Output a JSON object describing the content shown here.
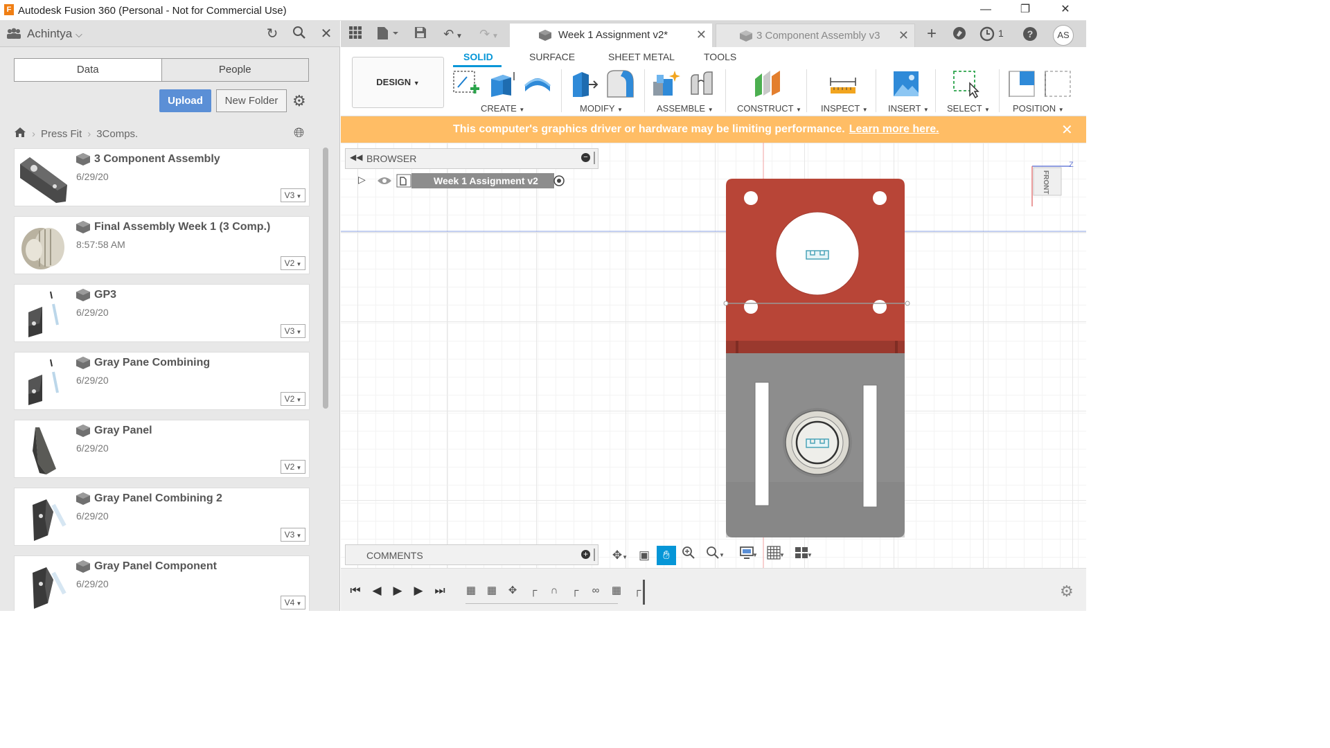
{
  "window": {
    "title": "Autodesk Fusion 360 (Personal - Not for Commercial Use)",
    "logo_letter": "F",
    "controls": [
      "—",
      "❐",
      "✕"
    ]
  },
  "data_panel": {
    "user": "Achintya",
    "tabs": [
      "Data",
      "People"
    ],
    "upload_label": "Upload",
    "new_folder_label": "New Folder",
    "breadcrumb": [
      "Press Fit",
      "3Comps."
    ],
    "files": [
      {
        "name": "3 Component Assembly",
        "date": "6/29/20",
        "version": "V3",
        "thumb": "plate"
      },
      {
        "name": "Final Assembly Week 1 (3 Comp.)",
        "date": "8:57:58 AM",
        "version": "V2",
        "thumb": "disc"
      },
      {
        "name": "GP3",
        "date": "6/29/20",
        "version": "V3",
        "thumb": "bracket"
      },
      {
        "name": "Gray Pane Combining",
        "date": "6/29/20",
        "version": "V2",
        "thumb": "bracket"
      },
      {
        "name": "Gray Panel",
        "date": "6/29/20",
        "version": "V2",
        "thumb": "panel"
      },
      {
        "name": "Gray Panel Combining 2",
        "date": "6/29/20",
        "version": "V3",
        "thumb": "bracket2"
      },
      {
        "name": "Gray Panel Component",
        "date": "6/29/20",
        "version": "V4",
        "thumb": "bracket2"
      }
    ]
  },
  "doc_tabs": [
    {
      "label": "Week 1 Assignment v2*",
      "active": true
    },
    {
      "label": "3 Component Assembly v3",
      "active": false
    }
  ],
  "header_right": {
    "job_count": "1",
    "avatar_initials": "AS"
  },
  "ribbon": {
    "workspace": "DESIGN",
    "tabs": [
      "SOLID",
      "SURFACE",
      "SHEET METAL",
      "TOOLS"
    ],
    "groups": [
      "CREATE",
      "MODIFY",
      "ASSEMBLE",
      "CONSTRUCT",
      "INSPECT",
      "INSERT",
      "SELECT",
      "POSITION"
    ]
  },
  "banner": {
    "message": "This computer's graphics driver or hardware may be limiting performance.",
    "link": "Learn more here."
  },
  "browser": {
    "title": "BROWSER",
    "root_node": "Week 1 Assignment v2"
  },
  "comments": {
    "title": "COMMENTS"
  },
  "viewcube": {
    "face": "FRONT",
    "axis_label": "Z"
  },
  "colors": {
    "accent": "#0696d7",
    "upload": "#5b8fd6",
    "banner": "#ffbd65",
    "model_red": "#b84537",
    "model_gray": "#8a8a8a"
  }
}
